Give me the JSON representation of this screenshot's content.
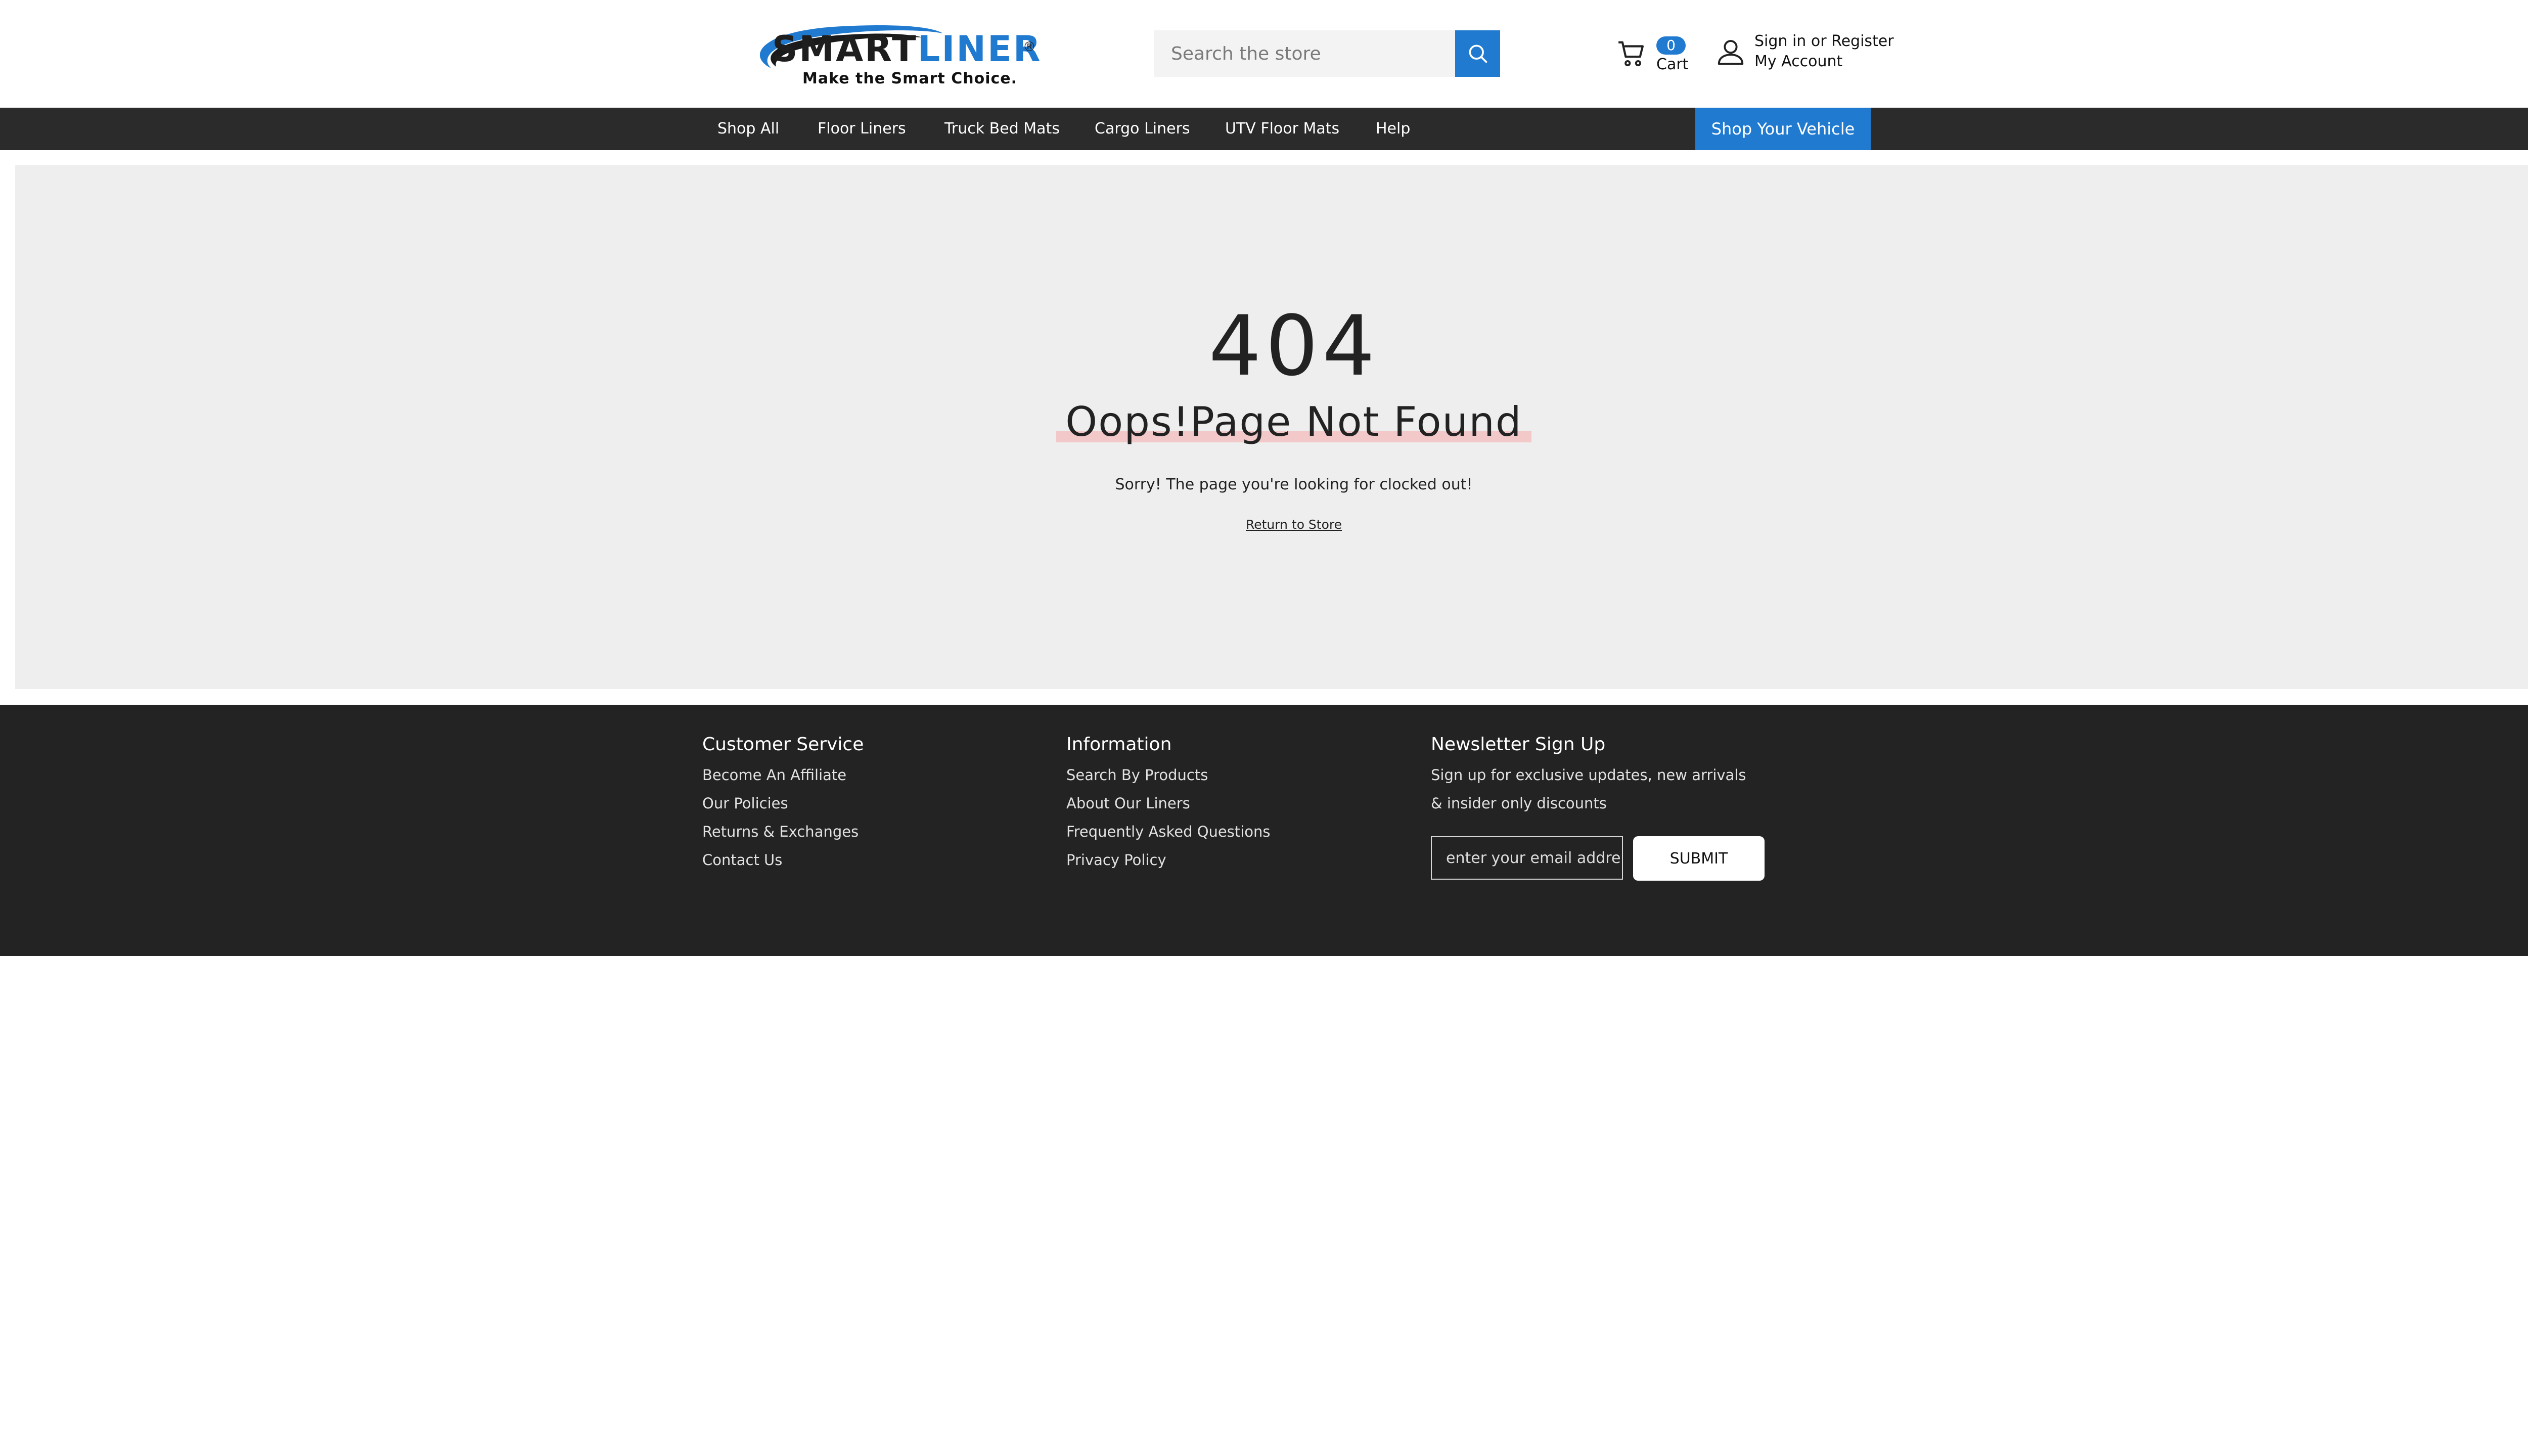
{
  "header": {
    "logo": {
      "word_part1": "SMART",
      "word_part2": "LINER",
      "registered": "®",
      "tagline": "Make the Smart Choice."
    },
    "search": {
      "placeholder": "Search the store",
      "button_icon": "search-icon"
    },
    "cart": {
      "count": "0",
      "label": "Cart",
      "icon": "cart-icon"
    },
    "account": {
      "line1": "Sign in or Register",
      "line2": "My Account",
      "icon": "user-icon"
    }
  },
  "nav": {
    "items": [
      {
        "label": "Shop All"
      },
      {
        "label": "Floor Liners"
      },
      {
        "label": "Truck Bed Mats"
      },
      {
        "label": "Cargo Liners"
      },
      {
        "label": "UTV Floor Mats"
      },
      {
        "label": "Help"
      }
    ],
    "cta": "Shop Your Vehicle"
  },
  "error": {
    "code": "404",
    "heading": "Oops!Page Not Found",
    "message": "Sorry! The page you're looking for clocked out!",
    "link": "Return to Store"
  },
  "footer": {
    "customer_service": {
      "title": "Customer Service",
      "links": [
        "Become An Affiliate",
        "Our Policies",
        "Returns & Exchanges",
        "Contact Us"
      ]
    },
    "information": {
      "title": "Information",
      "links": [
        "Search By Products",
        "About Our Liners",
        "Frequently Asked Questions",
        "Privacy Policy"
      ]
    },
    "newsletter": {
      "title": "Newsletter Sign Up",
      "text": "Sign up for exclusive updates, new arrivals & insider only discounts",
      "email_placeholder": "enter your email address",
      "submit": "SUBMIT"
    }
  },
  "colors": {
    "accent": "#1f7ad0",
    "nav_bg": "#2b2b2b",
    "footer_bg": "#232323",
    "panel_bg": "#eeeeee",
    "highlight": "#f2c8c8"
  }
}
